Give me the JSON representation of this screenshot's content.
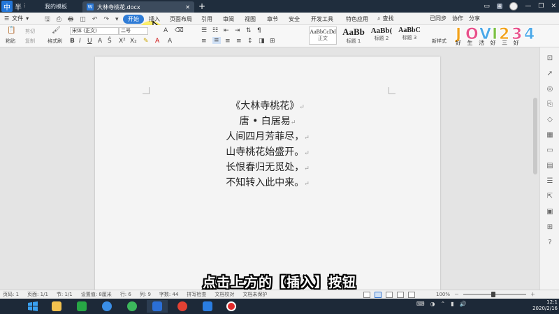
{
  "ime": {
    "lang": "中",
    "width_mode": "半",
    "dots": "⁝"
  },
  "tabs": {
    "template": "我的模板",
    "document": "大林寺桃花.docx"
  },
  "window_controls": {
    "badge": "4"
  },
  "menu": {
    "file": "文件",
    "tabs": [
      "开始",
      "插入",
      "页面布局",
      "引用",
      "审阅",
      "视图",
      "章节",
      "安全",
      "开发工具",
      "特色应用"
    ],
    "search": "查找",
    "sync": "已同步",
    "collab": "协作",
    "share": "分享"
  },
  "ribbon": {
    "paste": "粘贴",
    "cut": "剪切",
    "copy": "复制",
    "format_painter": "格式刷",
    "font_name": "宋体 (正文)",
    "font_size": "二号",
    "styles": [
      {
        "preview": "AaBbCcDd",
        "label": "正文"
      },
      {
        "preview": "AaBb",
        "label": "标题 1"
      },
      {
        "preview": "AaBb(",
        "label": "标题 2"
      },
      {
        "preview": "AaBbC",
        "label": "标题 3"
      }
    ],
    "new_style": "新样式",
    "logo_slogan": "好 生 活 好 三 好"
  },
  "document": {
    "lines": [
      "《大林寺桃花》",
      "唐 • 白居易",
      "人间四月芳菲尽，",
      "山寺桃花始盛开。",
      "长恨春归无觅处，",
      "不知转入此中来。"
    ],
    "paragraph_mark": "↵"
  },
  "caption": "点击上方的【插入】按钮",
  "status": {
    "page_num": "页码: 1",
    "pages": "页面: 1/1",
    "section": "节: 1/1",
    "setting": "设置值: 8厘米",
    "row": "行: 6",
    "col": "列: 9",
    "words": "字数: 44",
    "spell": "拼写检查",
    "proof": "文档校对",
    "unsaved": "文档未保护",
    "zoom": "100%"
  },
  "clock": {
    "time": "12:1",
    "date": "2020/2/16"
  },
  "colors": {
    "accent": "#2f7cd6",
    "tab_bg": "#1f2d3d",
    "taskbar": "#1d2938",
    "highlight": "#ffec3c"
  }
}
